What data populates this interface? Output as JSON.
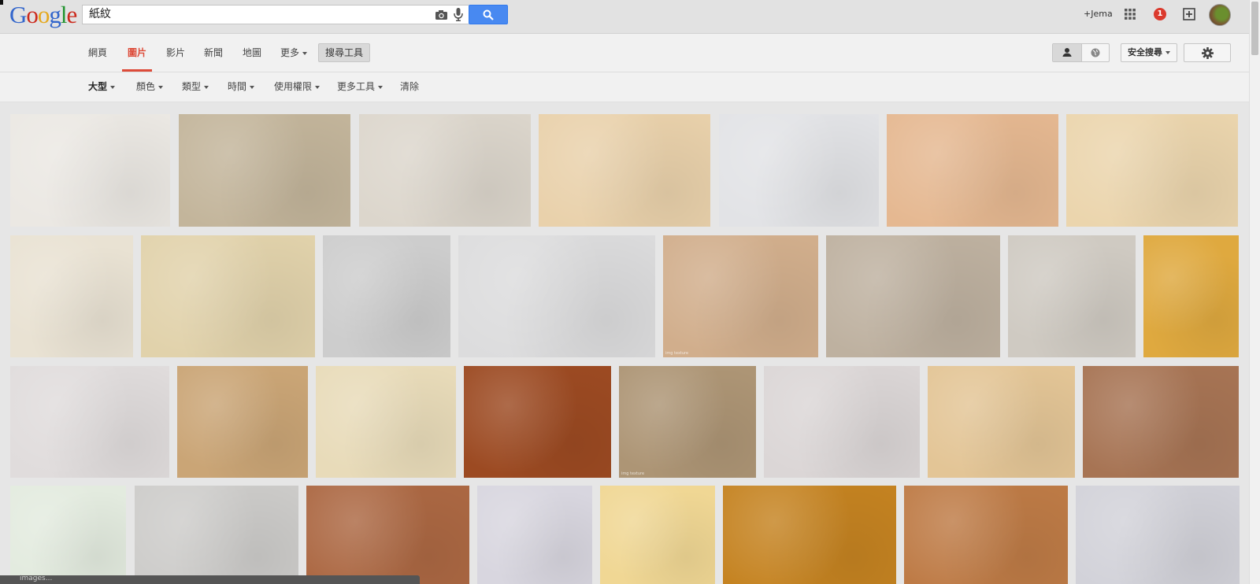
{
  "search": {
    "logo": "Google",
    "query": "紙紋"
  },
  "user": {
    "plus_label": "+Jema",
    "notifications": "1"
  },
  "nav": {
    "tabs": [
      {
        "label": "網頁"
      },
      {
        "label": "圖片",
        "active": true
      },
      {
        "label": "影片"
      },
      {
        "label": "新聞"
      },
      {
        "label": "地圖"
      },
      {
        "label": "更多"
      }
    ],
    "search_tools": "搜尋工具",
    "safesearch": "安全搜尋"
  },
  "tools": [
    {
      "label": "大型"
    },
    {
      "label": "顏色"
    },
    {
      "label": "類型"
    },
    {
      "label": "時間"
    },
    {
      "label": "使用權限"
    },
    {
      "label": "更多工具"
    },
    {
      "label": "清除"
    }
  ],
  "colors": {
    "accent_red": "#dd4b39",
    "search_blue": "#4889f1",
    "badge_red": "#db3a2d"
  },
  "image_rows": [
    [
      {
        "color": "#ebe8e3"
      },
      {
        "color": "#c3b59b"
      },
      {
        "color": "#dcd6cc"
      },
      {
        "color": "#e9d1ab"
      },
      {
        "color": "#e2e3e6"
      },
      {
        "color": "#e5b891"
      },
      {
        "color": "#ebd5ad"
      }
    ],
    [
      {
        "color": "#e9e2d3"
      },
      {
        "color": "#e1d2ab"
      },
      {
        "color": "#cdcdcd"
      },
      {
        "color": "#dcdcdd"
      },
      {
        "color": "#d1ae8c",
        "caption": "img  texture"
      },
      {
        "color": "#beb1a0"
      },
      {
        "color": "#cfcac2"
      },
      {
        "color": "#dfa93f"
      }
    ],
    [
      {
        "color": "#e0dcdc"
      },
      {
        "color": "#caa576"
      },
      {
        "color": "#e8dbb9"
      },
      {
        "color": "#9c4a22"
      },
      {
        "color": "#ad9575",
        "caption": "img  texture"
      },
      {
        "color": "#dbd6d6"
      },
      {
        "color": "#e3c596"
      },
      {
        "color": "#a77454"
      }
    ],
    [
      {
        "color": "#e3ebdf"
      },
      {
        "color": "#cdccca"
      },
      {
        "color": "#ac6843"
      },
      {
        "color": "#d8d6df"
      },
      {
        "color": "#f0d794"
      },
      {
        "color": "#c58321"
      },
      {
        "color": "#be7b46"
      },
      {
        "color": "#d2d2d9"
      }
    ]
  ],
  "status_bar": {
    "text": "images..."
  }
}
